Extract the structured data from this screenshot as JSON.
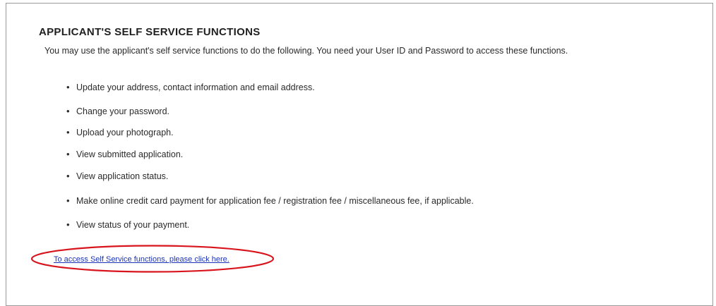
{
  "header": {
    "title": "APPLICANT'S SELF SERVICE FUNCTIONS"
  },
  "intro": {
    "text": "You may use the applicant's self service functions to do the following. You need your User ID and Password to access these functions."
  },
  "functions": [
    {
      "label": "Update your address, contact information and email address."
    },
    {
      "label": "Change your password."
    },
    {
      "label": "Upload your photograph."
    },
    {
      "label": "View submitted application."
    },
    {
      "label": "View application status."
    },
    {
      "label": "Make online credit card payment for application fee / registration fee / miscellaneous fee, if applicable."
    },
    {
      "label": "View status of your payment."
    }
  ],
  "access_link": {
    "label": "To access Self Service functions, please click here."
  },
  "colors": {
    "link": "#1a33b8",
    "highlight": "#d8141c"
  }
}
